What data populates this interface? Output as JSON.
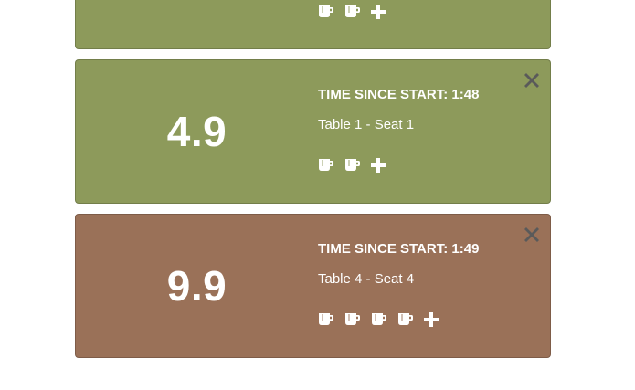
{
  "cards": [
    {
      "score": "",
      "time_label": "",
      "seat": "",
      "cups": 2,
      "color": "#8d9a5b"
    },
    {
      "score": "4.9",
      "time_label": "TIME SINCE START: 1:48",
      "seat": "Table 1 - Seat 1",
      "cups": 2,
      "color": "#8d9a5b"
    },
    {
      "score": "9.9",
      "time_label": "TIME SINCE START: 1:49",
      "seat": "Table 4 - Seat 4",
      "cups": 4,
      "color": "#9a7158"
    }
  ],
  "icons": {
    "cup": "coffee-cup-icon",
    "add": "plus-icon",
    "close": "close-icon"
  },
  "colors": {
    "icon": "#ffffff",
    "close": "#5a5a5a"
  }
}
